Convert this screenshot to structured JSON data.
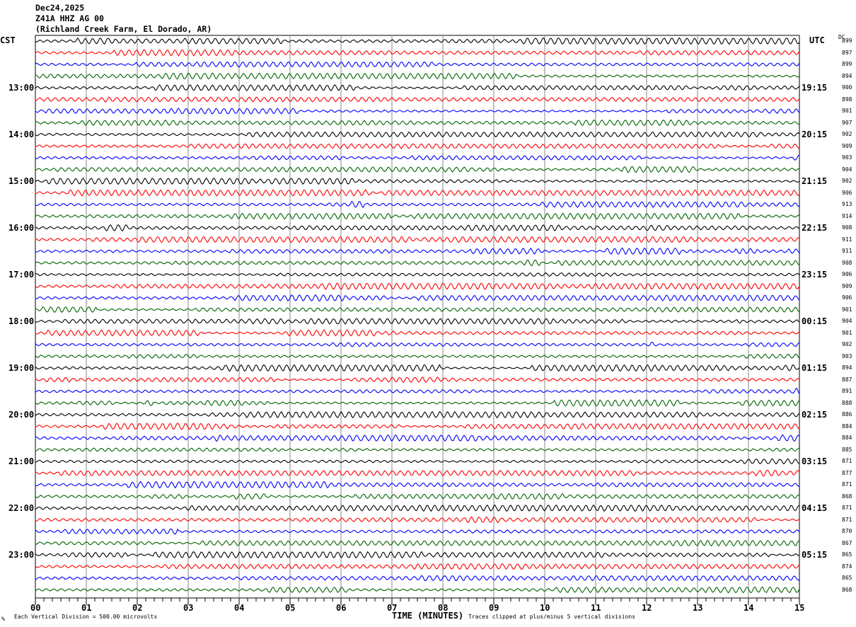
{
  "header": {
    "date": "Dec24,2025",
    "station": "Z41A HHZ AG 00",
    "location": "(Richland Creek Farm, El Dorado, AR)"
  },
  "left_axis_title": "CST",
  "right_axis_title": "UTC",
  "dc_title": "DC",
  "footer": {
    "scale": "Each Vertical Division =  500.00 microvolts",
    "xlabel": "TIME (MINUTES)",
    "clip": "Traces clipped at plus/minus 5 vertical divisions",
    "mark": "%"
  },
  "chart_data": {
    "type": "line",
    "title": "Z41A HHZ AG 00 helicorder",
    "xlabel": "TIME (MINUTES)",
    "xlim": [
      0,
      15
    ],
    "x_ticks": [
      "00",
      "01",
      "02",
      "03",
      "04",
      "05",
      "06",
      "07",
      "08",
      "09",
      "10",
      "11",
      "12",
      "13",
      "14",
      "15"
    ],
    "rows_per_hour": 4,
    "trace_colors": [
      "#000000",
      "#ff0000",
      "#0000ff",
      "#006400"
    ],
    "cst_labels": [
      "13:00",
      "14:00",
      "15:00",
      "16:00",
      "17:00",
      "18:00",
      "19:00",
      "20:00",
      "21:00",
      "22:00",
      "23:00"
    ],
    "utc_labels": [
      "19:15",
      "20:15",
      "21:15",
      "22:15",
      "23:15",
      "00:15",
      "01:15",
      "02:15",
      "03:15",
      "04:15",
      "05:15"
    ],
    "dc_values": [
      "899",
      "897",
      "899",
      "894",
      "900",
      "898",
      "901",
      "907",
      "902",
      "909",
      "903",
      "904",
      "902",
      "906",
      "913",
      "914",
      "908",
      "911",
      "911",
      "908",
      "906",
      "909",
      "906",
      "901",
      "904",
      "901",
      "902",
      "903",
      "894",
      "887",
      "891",
      "888",
      "886",
      "884",
      "884",
      "885",
      "871",
      "877",
      "871",
      "868",
      "871",
      "871",
      "870",
      "867",
      "865",
      "874",
      "865",
      "868"
    ]
  }
}
